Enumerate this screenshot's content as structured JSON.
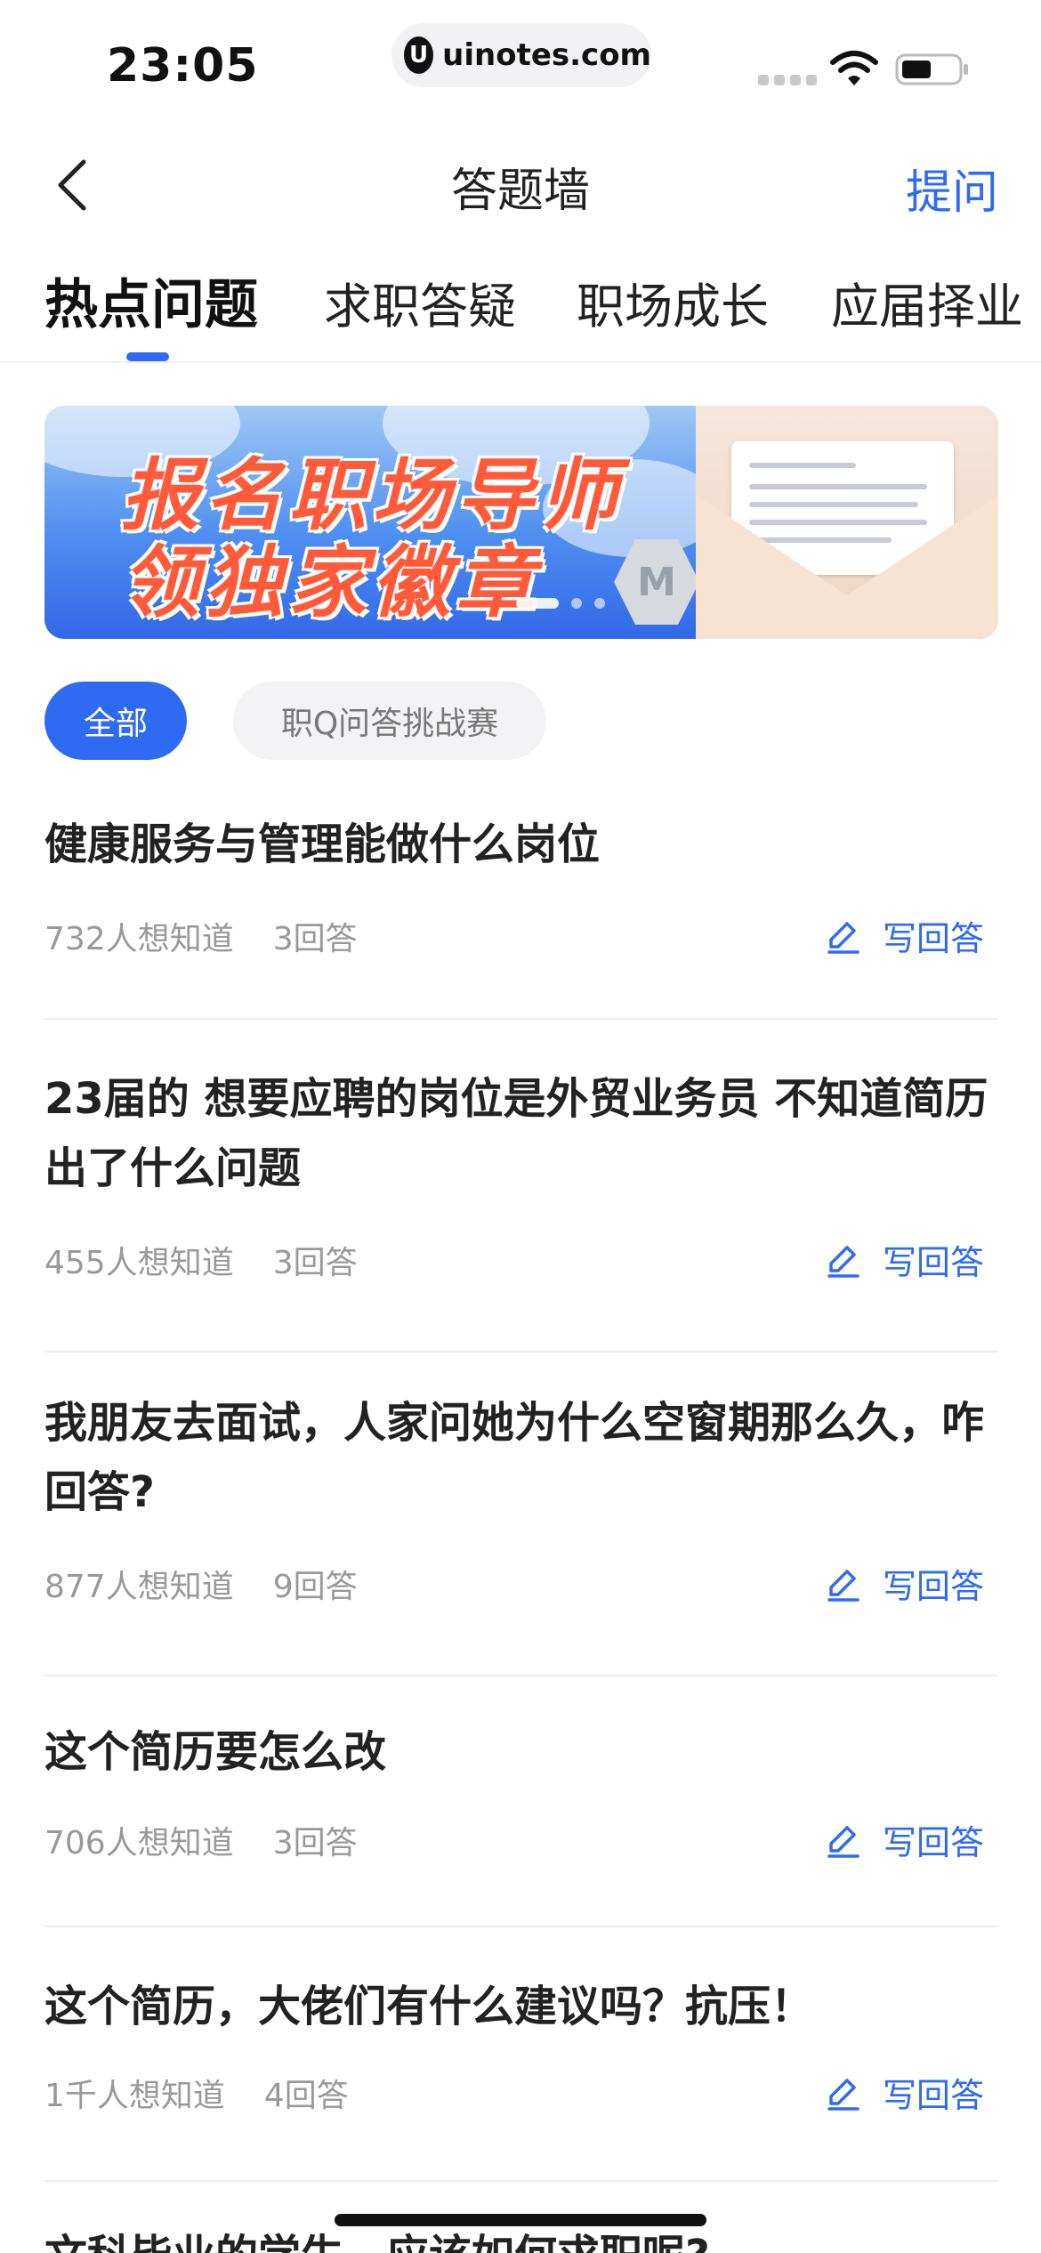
{
  "status_bar": {
    "time": "23:05",
    "url": "uinotes.com",
    "url_logo": "U",
    "icons": [
      "signal-icon",
      "wifi-icon",
      "battery-icon"
    ]
  },
  "nav": {
    "title": "答题墙",
    "ask_label": "提问",
    "back_icon": "chevron-left-icon"
  },
  "tabs": [
    {
      "label": "热点问题",
      "active": true
    },
    {
      "label": "求职答疑",
      "active": false
    },
    {
      "label": "职场成长",
      "active": false
    },
    {
      "label": "应届择业",
      "active": false
    }
  ],
  "banner": {
    "line1": "报名职场导师",
    "line2": "领独家徽章",
    "badge": "M",
    "slides": 3,
    "active_slide": 1
  },
  "filters": [
    {
      "label": "全部",
      "selected": true
    },
    {
      "label": "职Q问答挑战赛",
      "selected": false
    }
  ],
  "questions": [
    {
      "title": "健康服务与管理能做什么岗位",
      "interest": "732人想知道",
      "answers": "3回答",
      "action": "写回答"
    },
    {
      "title": "23届的 想要应聘的岗位是外贸业务员 不知道简历出了什么问题",
      "interest": "455人想知道",
      "answers": "3回答",
      "action": "写回答"
    },
    {
      "title": "我朋友去面试，人家问她为什么空窗期那么久，咋回答?",
      "interest": "877人想知道",
      "answers": "9回答",
      "action": "写回答"
    },
    {
      "title": "这个简历要怎么改",
      "interest": "706人想知道",
      "answers": "3回答",
      "action": "写回答"
    },
    {
      "title": "这个简历，大佬们有什么建议吗？抗压！",
      "interest": "1千人想知道",
      "answers": "4回答",
      "action": "写回答"
    },
    {
      "title": "文科毕业的学生，应该如何求职呢?",
      "interest": "",
      "answers": "",
      "action": ""
    }
  ],
  "colors": {
    "accent": "#2f6bf2",
    "text": "#222222",
    "muted": "#999999",
    "chip_bg": "#f3f3f5"
  }
}
